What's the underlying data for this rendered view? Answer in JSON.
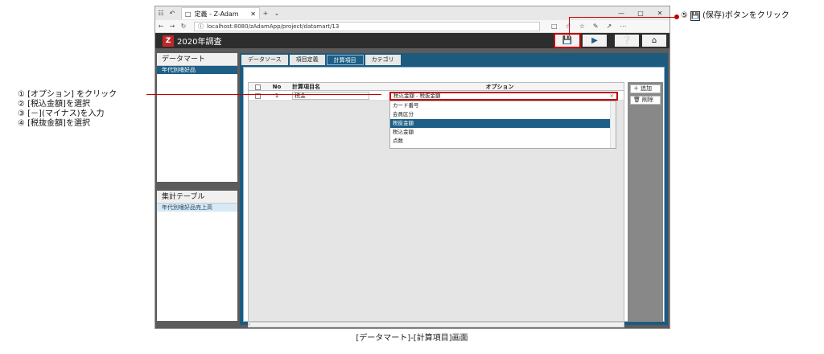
{
  "annotations": {
    "left_steps": [
      "① [オプション] をクリック",
      "② [税込金額]を選択",
      "③ [－](マイナス)を入力",
      "④ [税抜金額]を選択"
    ],
    "right_step_prefix": "⑤",
    "right_step_suffix": "(保存)ボタンをクリック",
    "caption": "[データマート]-[計算項目]画面",
    "accent_color": "#c00000"
  },
  "browser": {
    "tab_title": "定義 - Z-Adam",
    "url": "localhost:8080/zAdamApp/project/datamart/13"
  },
  "app": {
    "title": "2020年調査",
    "left_panel": {
      "header": "データマート",
      "selected_item": "年代別嗜好品"
    },
    "left_panel2": {
      "header": "集計テーブル",
      "item": "年代別嗜好品売上高"
    },
    "tabs": [
      "データソース",
      "項目定義",
      "計算項目",
      "カテゴリ"
    ],
    "active_tab": "計算項目",
    "grid": {
      "headers": {
        "no": "No",
        "name": "計算項目名",
        "option": "オプション"
      },
      "row": {
        "no": "1",
        "name": "税金"
      }
    },
    "dropdown": {
      "value": "税込金額 - 税抜金額",
      "options": [
        "カード番号",
        "会員区分",
        "税抜金額",
        "税込金額",
        "点数"
      ],
      "selected": "税抜金額"
    },
    "side_buttons": {
      "add": "追加",
      "delete": "削除"
    }
  }
}
